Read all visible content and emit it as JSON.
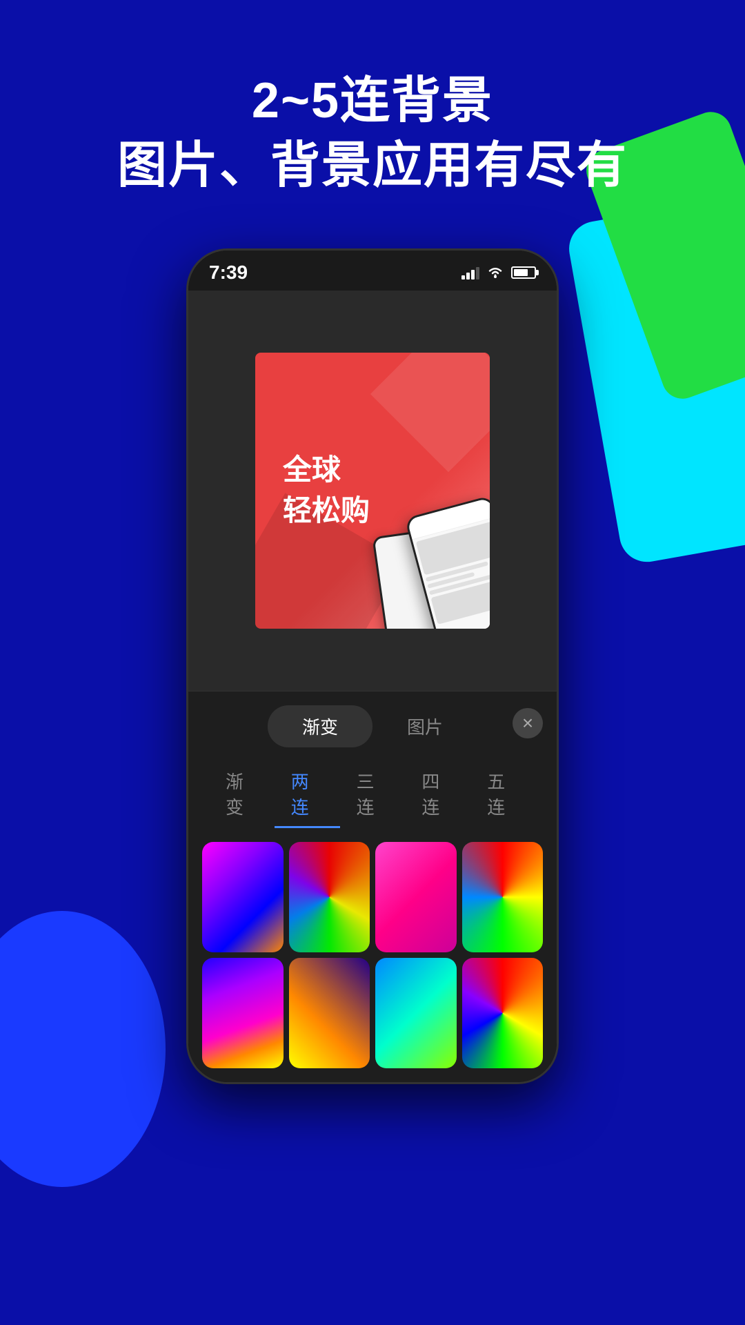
{
  "background": {
    "color": "#0a0fa8"
  },
  "header": {
    "line1": "2~5连背景",
    "line2": "图片、背景应用有尽有"
  },
  "status_bar": {
    "time": "7:39",
    "signal": "signal",
    "wifi": "wifi",
    "battery": "battery"
  },
  "preview": {
    "card_text_line1": "全球",
    "card_text_line2": "轻松购"
  },
  "bottom_panel": {
    "tab1": "渐变",
    "tab2": "图片",
    "close": "×",
    "sub_tabs": [
      "渐变",
      "两连",
      "三连",
      "四连",
      "五连"
    ],
    "active_tab_index": 1
  }
}
